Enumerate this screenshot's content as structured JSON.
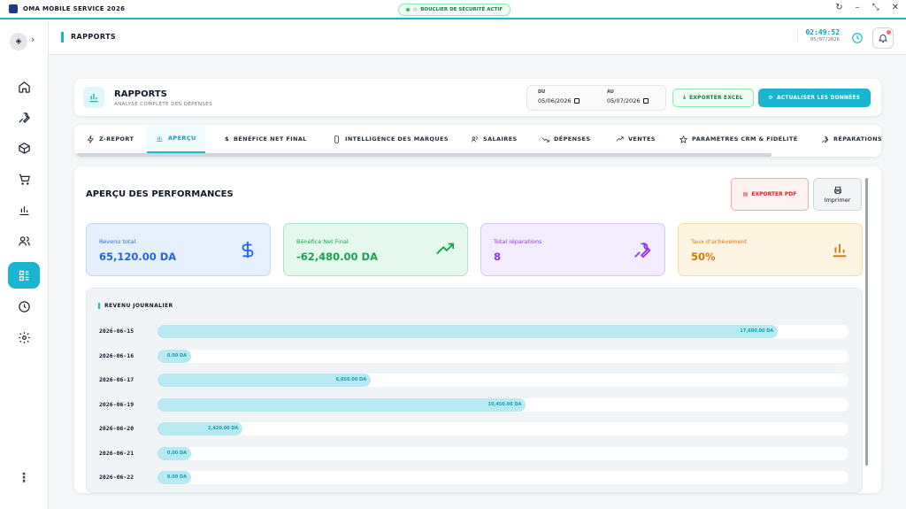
{
  "app": {
    "title": "OMA MOBILE SERVICE 2026",
    "shield_label": "BOUCLIER DE SÉCURITÉ ACTIF"
  },
  "topbar": {
    "page_title": "RAPPORTS",
    "time": "02:49:52",
    "date": "05/07/2026"
  },
  "header": {
    "title": "RAPPORTS",
    "subtitle": "ANALYSE COMPLÈTE DES DÉPENSES",
    "from_label": "DU",
    "from_value": "05/06/2026",
    "to_label": "AU",
    "to_value": "05/07/2026",
    "export_excel": "EXPORTER EXCEL",
    "refresh": "ACTUALISER LES DONNÉES"
  },
  "tabs": [
    {
      "label": "Z-REPORT",
      "icon": "zap-icon"
    },
    {
      "label": "APERÇU",
      "icon": "bar-chart-icon",
      "active": true
    },
    {
      "label": "BÉNÉFICE NET FINAL",
      "icon": "dollar-icon"
    },
    {
      "label": "INTELLIGENCE DES MARQUES",
      "icon": "phone-icon"
    },
    {
      "label": "SALAIRES",
      "icon": "users-icon"
    },
    {
      "label": "DÉPENSES",
      "icon": "trending-down-icon"
    },
    {
      "label": "VENTES",
      "icon": "trending-up-icon"
    },
    {
      "label": "PARAMÈTRES CRM & FIDÉLITÉ",
      "icon": "star-icon"
    },
    {
      "label": "RÉPARATIONS",
      "icon": "wrench-icon"
    }
  ],
  "overview": {
    "title": "APERÇU DES PERFORMANCES",
    "export_pdf": "EXPORTER PDF",
    "print": "Imprimer",
    "stats": [
      {
        "label": "Revenu total",
        "value": "65,120.00 DA",
        "icon": "dollar-icon",
        "color": "#2563eb",
        "bg": "#e6f0fd",
        "border": "#bfd7f8"
      },
      {
        "label": "Bénéfice Net Final",
        "value": "-62,480.00 DA",
        "icon": "trending-up-icon",
        "color": "#16a34a",
        "bg": "#e5f8ee",
        "border": "#a7e6c3"
      },
      {
        "label": "Total réparations",
        "value": "8",
        "icon": "wrench-icon",
        "color": "#9333ea",
        "bg": "#f3ecfd",
        "border": "#dcc6f8"
      },
      {
        "label": "Taux d'achèvement",
        "value": "50%",
        "icon": "bar-chart-icon",
        "color": "#d97706",
        "bg": "#fdf5e1",
        "border": "#f5dc9f"
      }
    ]
  },
  "chart_data": {
    "type": "bar",
    "title": "REVENU JOURNALIER",
    "categories": [
      "2026-06-15",
      "2026-06-16",
      "2026-06-17",
      "2026-06-19",
      "2026-06-20",
      "2026-06-21",
      "2026-06-22"
    ],
    "values": [
      17600,
      0,
      6050,
      10450,
      2420,
      0,
      0
    ],
    "value_labels": [
      "17,600.00 DA",
      "0.00 DA",
      "6,050.00 DA",
      "10,450.00 DA",
      "2,420.00 DA",
      "0.00 DA",
      "0.00 DA"
    ],
    "xlim": [
      0,
      19600
    ],
    "orientation": "horizontal",
    "color": "#b8e8f1"
  }
}
